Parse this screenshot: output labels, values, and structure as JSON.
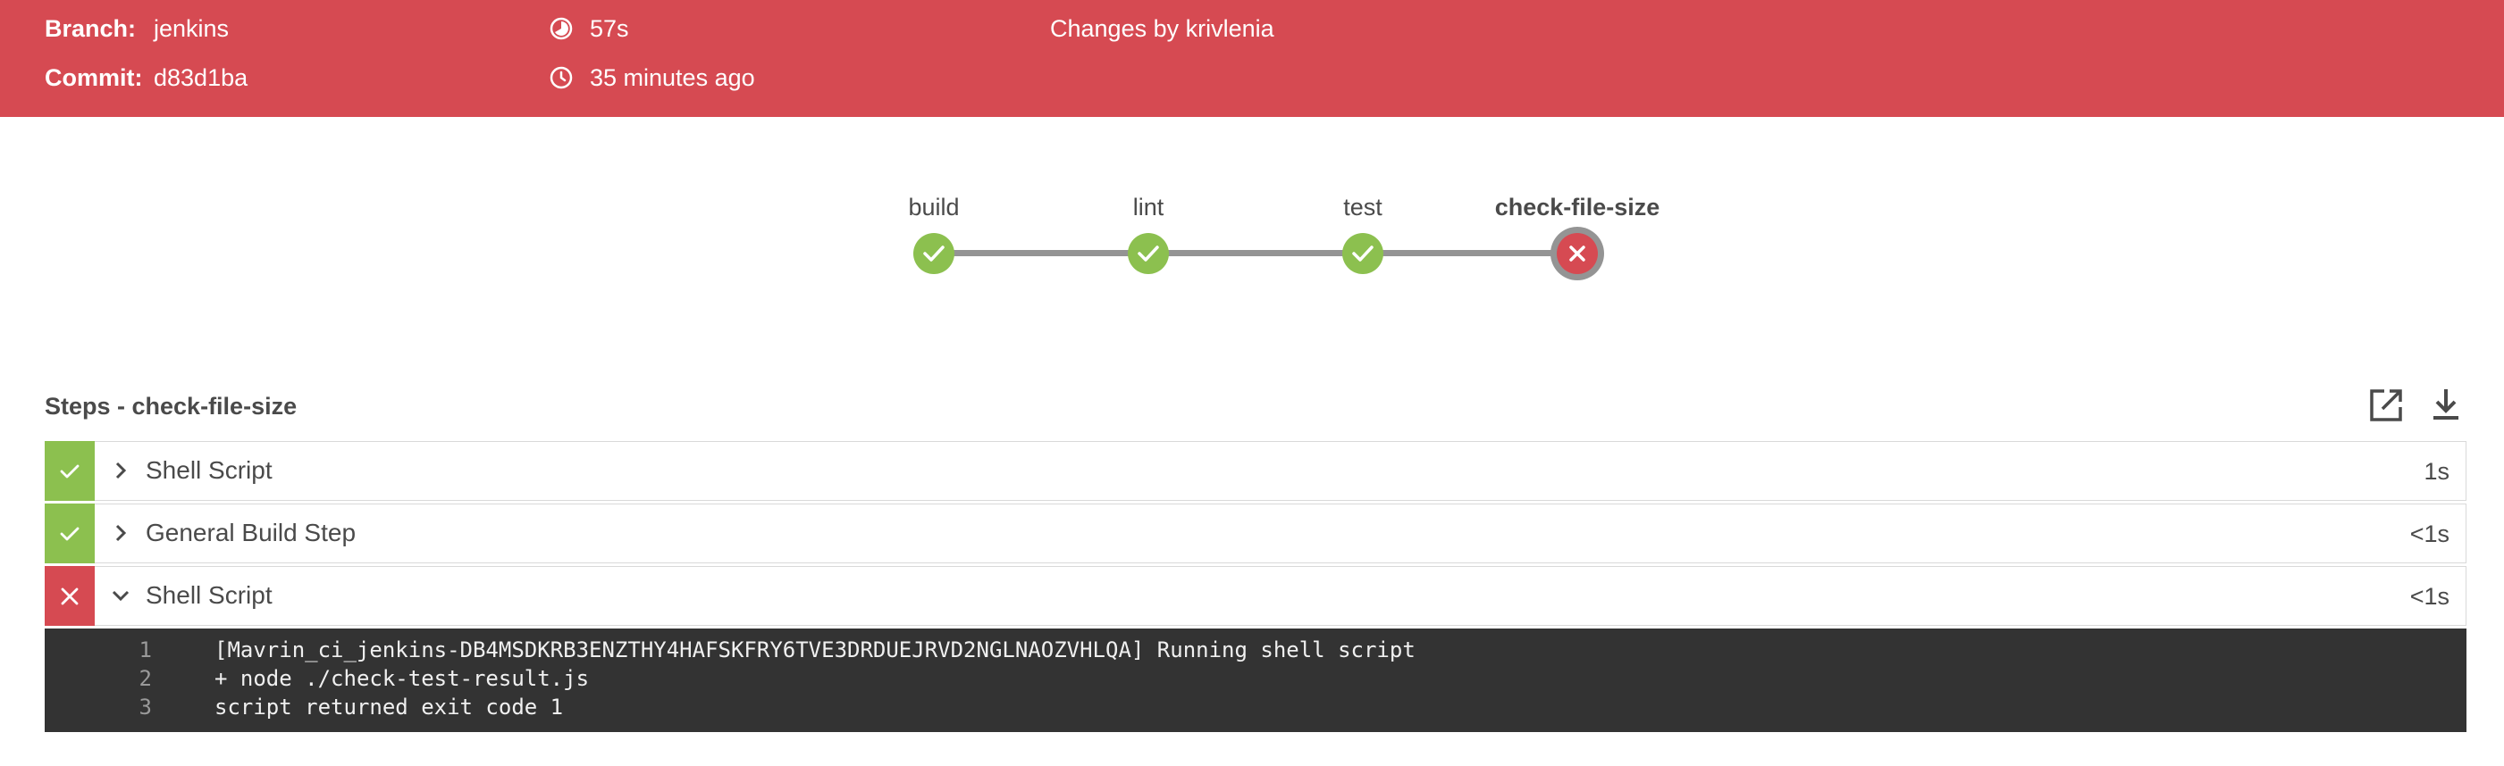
{
  "header": {
    "branch_label": "Branch:",
    "branch_value": "jenkins",
    "commit_label": "Commit:",
    "commit_value": "d83d1ba",
    "duration": "57s",
    "time_ago": "35 minutes ago",
    "changes": "Changes by krivlenia",
    "background_color": "#d64a52"
  },
  "pipeline": {
    "stages": [
      {
        "name": "build",
        "status": "success"
      },
      {
        "name": "lint",
        "status": "success"
      },
      {
        "name": "test",
        "status": "success"
      },
      {
        "name": "check-file-size",
        "status": "failure"
      }
    ],
    "success_color": "#8cc04f",
    "failure_color": "#d64a52"
  },
  "steps": {
    "title": "Steps - check-file-size",
    "icons": [
      "open-external-icon",
      "download-icon"
    ],
    "items": [
      {
        "label": "Shell Script",
        "duration": "1s",
        "status": "success",
        "expanded": false
      },
      {
        "label": "General Build Step",
        "duration": "<1s",
        "status": "success",
        "expanded": false
      },
      {
        "label": "Shell Script",
        "duration": "<1s",
        "status": "failure",
        "expanded": true
      }
    ]
  },
  "log": {
    "lines": [
      {
        "num": "1",
        "text": "[Mavrin_ci_jenkins-DB4MSDKRB3ENZTHY4HAFSKFRY6TVE3DRDUEJRVD2NGLNAOZVHLQA] Running shell script"
      },
      {
        "num": "2",
        "text": "+ node ./check-test-result.js"
      },
      {
        "num": "3",
        "text": "script returned exit code 1"
      }
    ]
  }
}
